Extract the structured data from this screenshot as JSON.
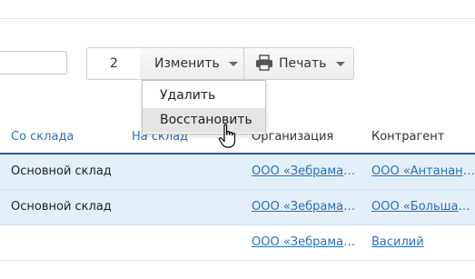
{
  "toolbar": {
    "selected_count": "2",
    "edit_label": "Изменить",
    "print_label": "Печать"
  },
  "edit_menu": {
    "items": [
      "Удалить",
      "Восстановить"
    ],
    "hovered_item": "Восстановить"
  },
  "table": {
    "headers": [
      "Со склада",
      "На склад",
      "Организация",
      "Контрагент"
    ],
    "rows": [
      {
        "from_store": "Основной склад",
        "to_store": "",
        "organization": "ООО «Зебрамарк...",
        "counterparty": "ООО «Антананар...",
        "selected": true
      },
      {
        "from_store": "Основной склад",
        "to_store": "",
        "organization": "ООО «Зебрамарк...",
        "counterparty": "ООО «Большая с...",
        "selected": true
      },
      {
        "from_store": "",
        "to_store": "",
        "organization": "ООО «Зебрамарк...",
        "counterparty": "Василий",
        "selected": false
      }
    ]
  },
  "colors": {
    "link": "#2a6ebb",
    "selected_row_bg": "#e3f0fa",
    "header_rule": "#1f5f96",
    "menu_hover_bg": "#e4e4e4"
  }
}
